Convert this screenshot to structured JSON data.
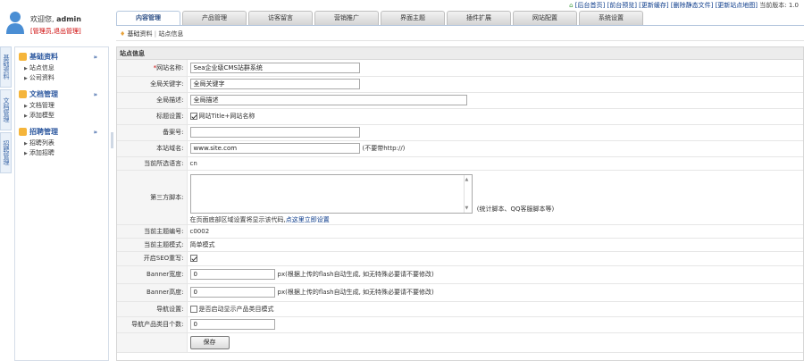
{
  "header": {
    "welcome_prefix": "欢迎您,",
    "username": "admin",
    "user_links": "[管理员,退出管理]",
    "toplinks": {
      "home": "[后台首页]",
      "site": "[前台预览]",
      "update_cache": "[更新缓存]",
      "clear_files": "[删除静态文件]",
      "update_sitemap": "[更新站点地图]",
      "version": "当前版本: 1.0"
    }
  },
  "tabs": [
    {
      "label": "内容管理",
      "active": true
    },
    {
      "label": "产品管理",
      "active": false
    },
    {
      "label": "访客留言",
      "active": false
    },
    {
      "label": "营销推广",
      "active": false
    },
    {
      "label": "界面主题",
      "active": false
    },
    {
      "label": "插件扩展",
      "active": false
    },
    {
      "label": "网站配置",
      "active": false
    },
    {
      "label": "系统设置",
      "active": false
    }
  ],
  "subnav": {
    "item1": "基础资料",
    "separator": "|",
    "item2": "站点信息"
  },
  "vtabs": [
    "基础资料",
    "文档管理",
    "招聘管理"
  ],
  "sidebar": {
    "groups": [
      {
        "title": "基础资料",
        "items": [
          "站点信息",
          "公司资料"
        ]
      },
      {
        "title": "文档管理",
        "items": [
          "文档管理",
          "添加模型"
        ]
      },
      {
        "title": "招聘管理",
        "items": [
          "招聘列表",
          "添加招聘"
        ]
      }
    ],
    "collapse_symbol": "»"
  },
  "panel": {
    "title": "站点信息"
  },
  "form": {
    "site_name": {
      "label": "网站名称:",
      "value": "Sea企业级CMS站群系统"
    },
    "keywords": {
      "label": "全局关键字:",
      "value": "全局关键字"
    },
    "description": {
      "label": "全局描述:",
      "value": "全局描述"
    },
    "title_setting": {
      "label": "标题设置:",
      "option": "网站Title+网站名称",
      "checked": true
    },
    "icp": {
      "label": "备案号:",
      "value": ""
    },
    "domain": {
      "label": "本站域名:",
      "value": "www.site.com",
      "hint": "(不要带http://)"
    },
    "language": {
      "label": "当前所选语言:",
      "value": "cn"
    },
    "third_party": {
      "label": "第三方脚本:",
      "hint": "(统计脚本、QQ客服脚本等)",
      "note": "在页面底部区域设置将显示该代码,",
      "note_link": "点这里立即设置"
    },
    "template_code": {
      "label": "当前主题编号:",
      "value": "c0002"
    },
    "template_mode": {
      "label": "当前主题模式:",
      "value": "简单模式"
    },
    "seo_rewrite": {
      "label": "开启SEO重写:",
      "checked": true
    },
    "banner_width": {
      "label": "Banner宽度:",
      "value": "0",
      "hint": "px(根据上传的flash自动生成, 如无特殊必要请不要修改)"
    },
    "banner_height": {
      "label": "Banner高度:",
      "value": "0",
      "hint": "px(根据上传的flash自动生成, 如无特殊必要请不要修改)"
    },
    "nav_setting": {
      "label": "导航设置:",
      "option": "是否启动显示产品类目模式",
      "checked": false
    },
    "nav_count": {
      "label": "导航产品类目个数:",
      "value": "0"
    },
    "save_label": "保存"
  }
}
